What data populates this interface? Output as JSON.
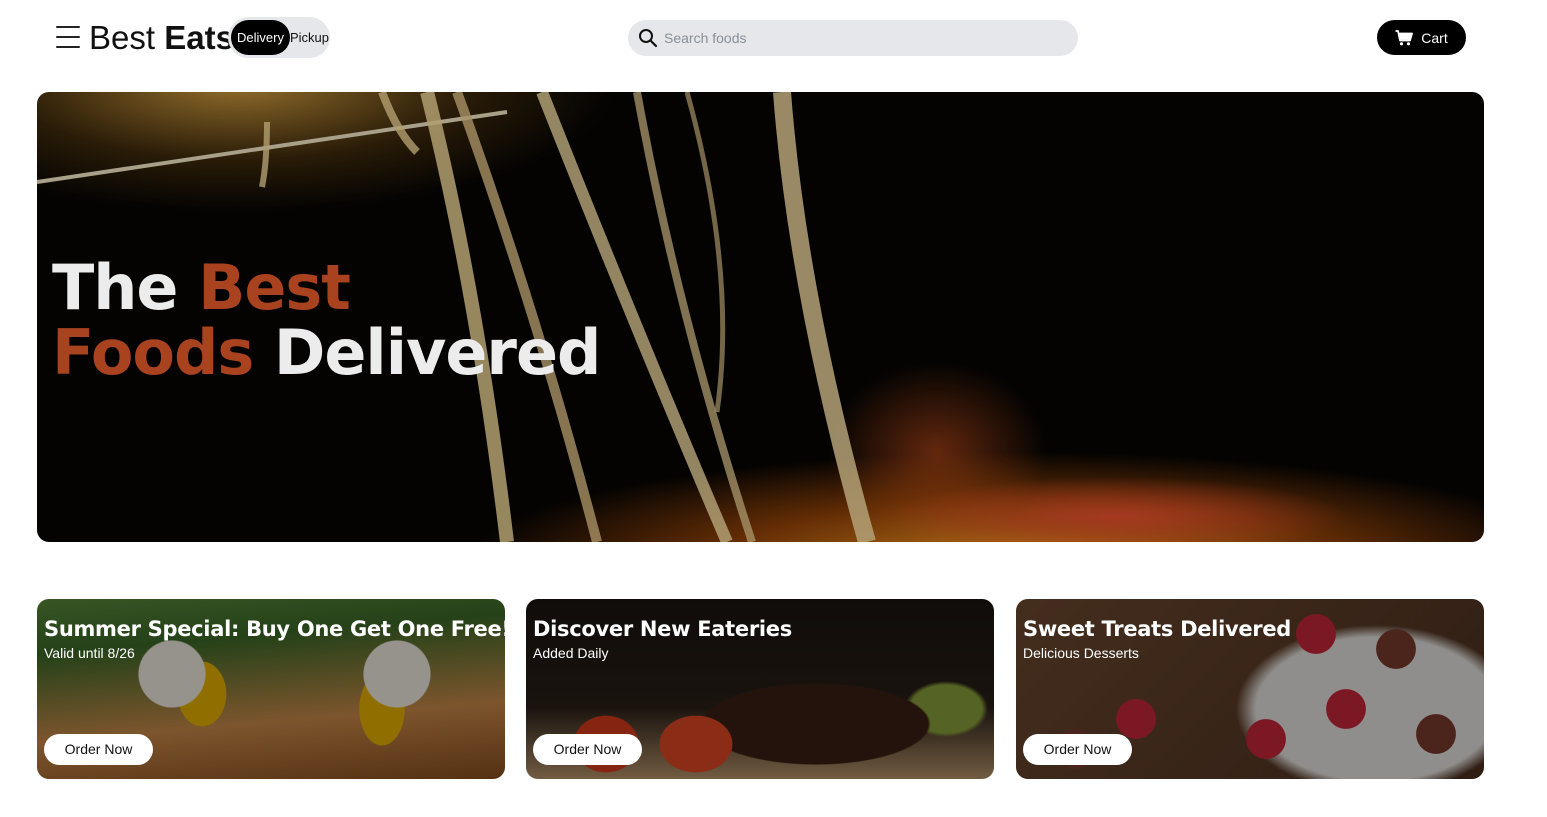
{
  "header": {
    "brand_part1": "Best",
    "brand_part2": "Eats",
    "mode_options": [
      "Delivery",
      "Pickup"
    ],
    "mode_selected": "Delivery",
    "search": {
      "placeholder": "Search foods",
      "value": ""
    },
    "cart_label": "Cart"
  },
  "hero": {
    "line1_part1": "The",
    "line1_part2": "Best",
    "line2_part1": "Foods",
    "line2_part2": "Delivered",
    "accent_color": "#a8421f"
  },
  "cards": [
    {
      "title": "Summer Special: Buy One Get One Free!",
      "subtitle": "Valid until 8/26",
      "button": "Order Now"
    },
    {
      "title": "Discover New Eateries",
      "subtitle": "Added Daily",
      "button": "Order Now"
    },
    {
      "title": "Sweet Treats Delivered",
      "subtitle": "Delicious Desserts",
      "button": "Order Now"
    }
  ],
  "colors": {
    "primary_button": "#000000",
    "toggle_bg": "#e5e7eb",
    "search_bg": "#e5e7eb"
  },
  "icons": [
    "menu-icon",
    "search-icon",
    "cart-icon"
  ]
}
